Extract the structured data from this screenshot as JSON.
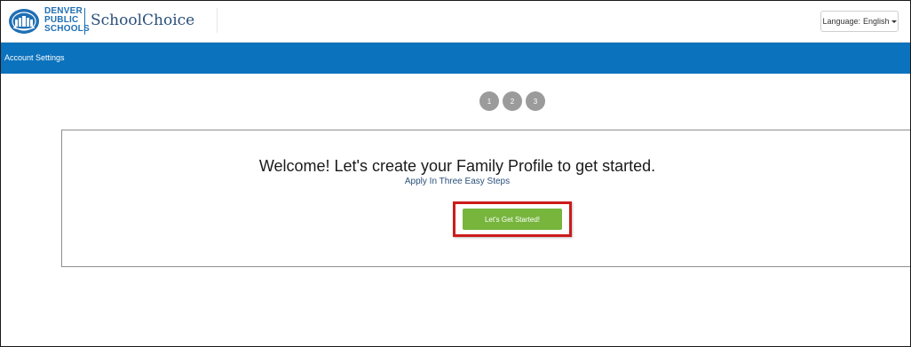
{
  "header": {
    "logo": {
      "line1": "DENVER",
      "line2": "PUBLIC",
      "line3": "SCHOOLS",
      "product": "SchoolChoice"
    },
    "language": {
      "label": "Language:",
      "value": "English"
    }
  },
  "nav": {
    "account_settings": "Account Settings"
  },
  "steps": [
    "1",
    "2",
    "3"
  ],
  "welcome": {
    "title": "Welcome! Let's create your Family Profile to get started.",
    "subtitle": "Apply In Three Easy Steps",
    "cta": "Let's Get Started!"
  },
  "colors": {
    "nav_bar": "#0b72bd",
    "cta": "#77b53d",
    "highlight": "#cc1b1b",
    "step_inactive": "#9b9b9b",
    "logo_blue": "#1f6fb4"
  }
}
